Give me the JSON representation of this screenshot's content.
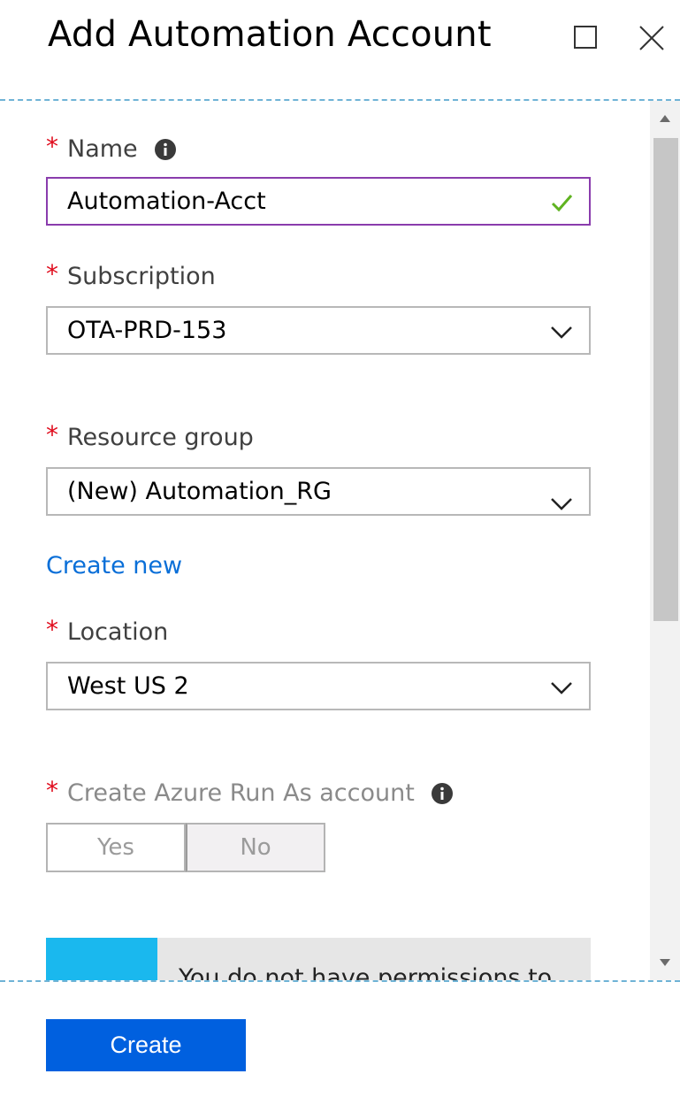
{
  "header": {
    "title": "Add Automation Account"
  },
  "form": {
    "name": {
      "label": "Name",
      "value": "Automation-Acct"
    },
    "subscription": {
      "label": "Subscription",
      "value": "OTA-PRD-153"
    },
    "resource_group": {
      "label": "Resource group",
      "value": "(New) Automation_RG",
      "create_new_link": "Create new"
    },
    "location": {
      "label": "Location",
      "value": "West US 2"
    },
    "run_as": {
      "label": "Create Azure Run As account",
      "yes_label": "Yes",
      "no_label": "No",
      "selected": "No"
    },
    "required_marker": "*"
  },
  "notice": {
    "text": "You do not have permissions to"
  },
  "footer": {
    "create_label": "Create"
  },
  "colors": {
    "accent": "#0060df",
    "link": "#0a6fd8",
    "active_border": "#8a3cad",
    "valid_check": "#5fb320",
    "required": "#e00b1c",
    "notice_bar": "#1ab8ee"
  },
  "icons": {
    "maximize": "maximize-icon",
    "close": "close-icon",
    "info": "info-icon",
    "valid": "checkmark-icon",
    "dropdown": "chevron-down-icon"
  }
}
